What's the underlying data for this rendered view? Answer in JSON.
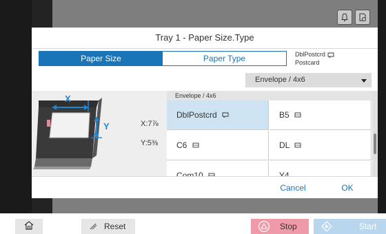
{
  "dialog": {
    "title": "Tray 1 - Paper Size.Type",
    "tabs": [
      {
        "label": "Paper Size",
        "active": true
      },
      {
        "label": "Paper Type",
        "active": false
      }
    ],
    "current_selection": {
      "line1": "DblPostcrd",
      "line2": "Postcard"
    },
    "dropdown": {
      "value": "Envelope / 4x6"
    },
    "preview": {
      "x_value": "X:7⅞",
      "y_value": "Y:5⅜",
      "x_axis": "X",
      "y_axis": "Y"
    },
    "list": {
      "header": "Envelope / 4x6",
      "items": [
        {
          "label": "DblPostcrd",
          "icon": "postcard-icon",
          "selected": true
        },
        {
          "label": "B5",
          "icon": "landscape-paper-icon",
          "selected": false
        },
        {
          "label": "C6",
          "icon": "landscape-paper-icon",
          "selected": false
        },
        {
          "label": "DL",
          "icon": "landscape-paper-icon",
          "selected": false
        },
        {
          "label": "Com10",
          "icon": "landscape-paper-icon",
          "selected": false
        },
        {
          "label": "Y4",
          "icon": "",
          "selected": false
        }
      ]
    },
    "cancel_label": "Cancel",
    "ok_label": "OK"
  },
  "hardware": {
    "reset_label": "Reset",
    "stop_label": "Stop",
    "start_label": "Start"
  },
  "colors": {
    "accent": "#1a75b8",
    "selected_row": "#cde3f1",
    "stop": "#ef9aa9",
    "start": "#b9d6ef"
  }
}
